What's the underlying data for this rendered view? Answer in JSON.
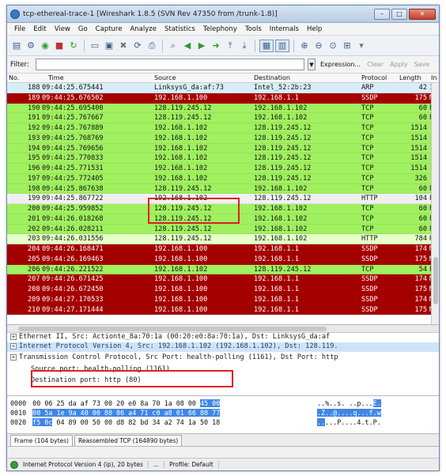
{
  "window": {
    "title": "tcp-ethereal-trace-1 [Wireshark 1.8.5 (SVN Rev 47350 from /trunk-1.8)]",
    "minimize": "–",
    "maximize": "□",
    "close": "✕"
  },
  "menu": [
    "File",
    "Edit",
    "View",
    "Go",
    "Capture",
    "Analyze",
    "Statistics",
    "Telephony",
    "Tools",
    "Internals",
    "Help"
  ],
  "filter": {
    "label": "Filter:",
    "value": "",
    "expression": "Expression...",
    "clear": "Clear",
    "apply": "Apply",
    "save": "Save"
  },
  "columns": {
    "no": "No.",
    "time": "Time",
    "source": "Source",
    "destination": "Destination",
    "protocol": "Protocol",
    "length": "Length",
    "info": "In"
  },
  "packets": [
    {
      "no": "188",
      "time": "09:44:25.675441",
      "src": "LinksysG_da:af:73",
      "dst": "Intel_52:2b:23",
      "proto": "ARP",
      "len": "42",
      "info": "1",
      "kind": "arp"
    },
    {
      "no": "189",
      "time": "09:44:25.676502",
      "src": "192.168.1.100",
      "dst": "192.168.1.1",
      "proto": "SSDP",
      "len": "175",
      "info": "M",
      "kind": "ssdp"
    },
    {
      "no": "190",
      "time": "09:44:25.695400",
      "src": "128.119.245.12",
      "dst": "192.168.1.102",
      "proto": "TCP",
      "len": "60",
      "info": "h",
      "kind": "tcp"
    },
    {
      "no": "191",
      "time": "09:44:25.767667",
      "src": "128.119.245.12",
      "dst": "192.168.1.102",
      "proto": "TCP",
      "len": "60",
      "info": "h",
      "kind": "tcp"
    },
    {
      "no": "192",
      "time": "09:44:25.767889",
      "src": "192.168.1.102",
      "dst": "128.119.245.12",
      "proto": "TCP",
      "len": "1514",
      "info": "[",
      "kind": "tcp"
    },
    {
      "no": "193",
      "time": "09:44:25.768769",
      "src": "192.168.1.102",
      "dst": "128.119.245.12",
      "proto": "TCP",
      "len": "1514",
      "info": "[",
      "kind": "tcp"
    },
    {
      "no": "194",
      "time": "09:44:25.769656",
      "src": "192.168.1.102",
      "dst": "128.119.245.12",
      "proto": "TCP",
      "len": "1514",
      "info": "[",
      "kind": "tcp"
    },
    {
      "no": "195",
      "time": "09:44:25.770833",
      "src": "192.168.1.102",
      "dst": "128.119.245.12",
      "proto": "TCP",
      "len": "1514",
      "info": "[",
      "kind": "tcp"
    },
    {
      "no": "196",
      "time": "09:44:25.771531",
      "src": "192.168.1.102",
      "dst": "128.119.245.12",
      "proto": "TCP",
      "len": "1514",
      "info": "[",
      "kind": "tcp"
    },
    {
      "no": "197",
      "time": "09:44:25.772405",
      "src": "192.168.1.102",
      "dst": "128.119.245.12",
      "proto": "TCP",
      "len": "326",
      "info": "[",
      "kind": "tcp"
    },
    {
      "no": "198",
      "time": "09:44:25.867638",
      "src": "128.119.245.12",
      "dst": "192.168.1.102",
      "proto": "TCP",
      "len": "60",
      "info": "h",
      "kind": "tcp"
    },
    {
      "no": "199",
      "time": "09:44:25.867722",
      "src": "192.168.1.102",
      "dst": "128.119.245.12",
      "proto": "HTTP",
      "len": "104",
      "info": "P",
      "kind": "selected-http"
    },
    {
      "no": "200",
      "time": "09:44:25.959852",
      "src": "128.119.245.12",
      "dst": "192.168.1.102",
      "proto": "TCP",
      "len": "60",
      "info": "h",
      "kind": "tcp"
    },
    {
      "no": "201",
      "time": "09:44:26.018268",
      "src": "128.119.245.12",
      "dst": "192.168.1.102",
      "proto": "TCP",
      "len": "60",
      "info": "h",
      "kind": "tcp"
    },
    {
      "no": "202",
      "time": "09:44:26.028211",
      "src": "128.119.245.12",
      "dst": "192.168.1.102",
      "proto": "TCP",
      "len": "60",
      "info": "h",
      "kind": "tcp"
    },
    {
      "no": "203",
      "time": "09:44:26.031556",
      "src": "128.119.245.12",
      "dst": "192.168.1.102",
      "proto": "HTTP",
      "len": "784",
      "info": "H",
      "kind": "http"
    },
    {
      "no": "204",
      "time": "09:44:26.168471",
      "src": "192.168.1.100",
      "dst": "192.168.1.1",
      "proto": "SSDP",
      "len": "174",
      "info": "M",
      "kind": "ssdp"
    },
    {
      "no": "205",
      "time": "09:44:26.169463",
      "src": "192.168.1.100",
      "dst": "192.168.1.1",
      "proto": "SSDP",
      "len": "175",
      "info": "M",
      "kind": "ssdp"
    },
    {
      "no": "206",
      "time": "09:44:26.221522",
      "src": "192.168.1.102",
      "dst": "128.119.245.12",
      "proto": "TCP",
      "len": "54",
      "info": "h",
      "kind": "tcp"
    },
    {
      "no": "207",
      "time": "09:44:26.671425",
      "src": "192.168.1.100",
      "dst": "192.168.1.1",
      "proto": "SSDP",
      "len": "174",
      "info": "M",
      "kind": "ssdp"
    },
    {
      "no": "208",
      "time": "09:44:26.672450",
      "src": "192.168.1.100",
      "dst": "192.168.1.1",
      "proto": "SSDP",
      "len": "175",
      "info": "M",
      "kind": "ssdp"
    },
    {
      "no": "209",
      "time": "09:44:27.170533",
      "src": "192.168.1.100",
      "dst": "192.168.1.1",
      "proto": "SSDP",
      "len": "174",
      "info": "M",
      "kind": "ssdp"
    },
    {
      "no": "210",
      "time": "09:44:27.171444",
      "src": "192.168.1.100",
      "dst": "192.168.1.1",
      "proto": "SSDP",
      "len": "175",
      "info": "M",
      "kind": "ssdp"
    }
  ],
  "details": [
    {
      "text": "Ethernet II, Src: Actionte_8a:70:1a (00:20:e0:8a:70:1a), Dst: LinksysG_da:af",
      "selected": false
    },
    {
      "text": "Internet Protocol Version 4, Src: 192.168.1.102 (192.168.1.102), Dst: 128.119.",
      "selected": true
    },
    {
      "text": "Transmission Control Protocol, Src Port: health-polling (1161), Dst Port: http",
      "selected": false
    },
    {
      "text": "Source port: health-polling (1161)",
      "selected": false
    },
    {
      "text": "Destination port: http (80)",
      "selected": false
    }
  ],
  "hex": [
    {
      "offset": "0000",
      "plain": "00 06 25 da af 73 00 20  e0 8a 70 1a 08 00 ",
      "hl": "45 00",
      "ascii_plain": "..%..s. ..p...",
      "ascii_hl": "E."
    },
    {
      "offset": "0010",
      "plain": "",
      "hl": "00 5a 1e 9a 40 00 80 06  a4 71 c0 a8 01 66 80 77",
      "ascii_plain": "",
      "ascii_hl": ".Z..@....q...f.w"
    },
    {
      "offset": "0020",
      "plain": "",
      "hl": "f5 0c",
      "rest": " 04 89 00 50 00 d8  82 bd 34 a2 74 1a 50 18",
      "ascii_hl": "..",
      "ascii_rest": "...P....4.t.P."
    }
  ],
  "hex_tabs": [
    "Frame (104 bytes)",
    "Reassembled TCP (164890 bytes)"
  ],
  "status": {
    "field": "Internet Protocol Version 4 (ip), 20 bytes",
    "ellipsis": "...",
    "profile": "Profile: Default"
  },
  "colors": {
    "ssdp": "#a40000",
    "tcp": "#a0f060",
    "http": "#e4ffc7",
    "highlight_box": "#e02020",
    "hex_highlight": "#3f86e6"
  }
}
